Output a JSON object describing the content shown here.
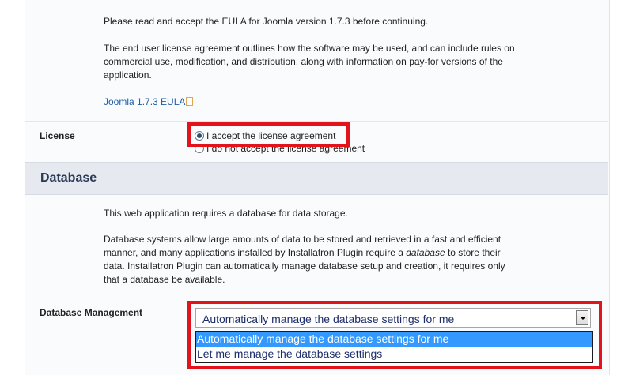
{
  "eula": {
    "intro": "Please read and accept the EULA for Joomla version 1.7.3 before continuing.",
    "description": "The end user license agreement outlines how the software may be used, and can include rules on commercial use, modification, and distribution, along with information on pay-for versions of the application.",
    "link_label": "Joomla 1.7.3 EULA"
  },
  "license": {
    "label": "License",
    "accept_label": "I accept the license agreement",
    "decline_label": "I do not accept the license agreement",
    "selected": "accept"
  },
  "database": {
    "section_title": "Database",
    "intro": "This web application requires a database for data storage.",
    "description_before": "Database systems allow large amounts of data to be stored and retrieved in a fast and efficient manner, and many applications installed by Installatron Plugin require a ",
    "description_emph": "database",
    "description_after": " to store their data. Installatron Plugin can automatically manage database setup and creation, it requires only that a database be available.",
    "management_label": "Database Management",
    "select_value": "Automatically manage the database settings for me",
    "options": [
      "Automatically manage the database settings for me",
      "Let me manage the database settings"
    ]
  },
  "colors": {
    "highlight_border": "#e3131b",
    "option_highlight": "#3399ff",
    "link": "#1f5fa8"
  }
}
